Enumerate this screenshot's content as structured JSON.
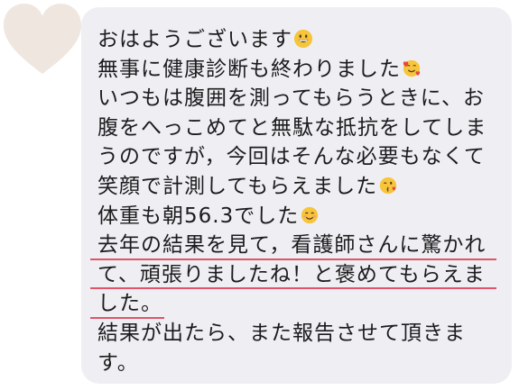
{
  "message": {
    "lines": [
      "おはようございます",
      "無事に健康診断も終わりました",
      "いつもは腹囲を測ってもらうときに、お",
      "腹をへっこめてと無駄な抵抗をしてしま",
      "うのですが，今回はそんな必要もなくて",
      "笑顔で計測してもらえました",
      "体重も朝56.3でした",
      "去年の結果を見て，看護師さんに驚かれ",
      "て、頑張りましたね！と褒めてもらえま",
      "した。",
      "結果が出たら、また報告させて頂きま",
      "す。"
    ],
    "emojis": [
      "grinning-face",
      "smiling-face-with-hearts",
      "face-blowing-kiss",
      "smiling-face-with-smiling-eyes"
    ]
  },
  "colors": {
    "bubble": "#efeff3",
    "text": "#1c1c1e",
    "underline": "#e0536a",
    "heart": "#efe6df"
  }
}
